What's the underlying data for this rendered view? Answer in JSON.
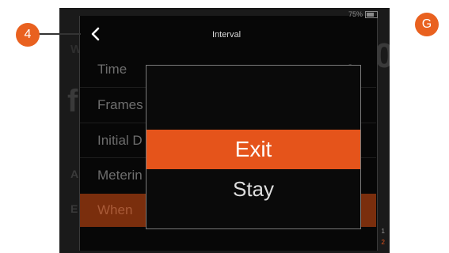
{
  "screen": {
    "title": "Interval",
    "battery_text": "75%",
    "battery_level": 0.75,
    "back_icon": "chevron-left-icon"
  },
  "menu_rows": [
    {
      "label": "Time",
      "value": "0"
    },
    {
      "label": "Frames",
      "value": ""
    },
    {
      "label": "Initial D",
      "value": ""
    },
    {
      "label": "Meterin",
      "value": ""
    },
    {
      "label": "When",
      "value": ""
    }
  ],
  "dialog": {
    "options": [
      "Exit",
      "Stay"
    ],
    "selected": "Exit"
  },
  "callouts": {
    "left": "4",
    "right": "G"
  },
  "side_numbers": [
    "1",
    "2"
  ],
  "colors": {
    "accent": "#e5541b",
    "callout": "#e9611f",
    "selected_row": "#7a2e0d"
  }
}
